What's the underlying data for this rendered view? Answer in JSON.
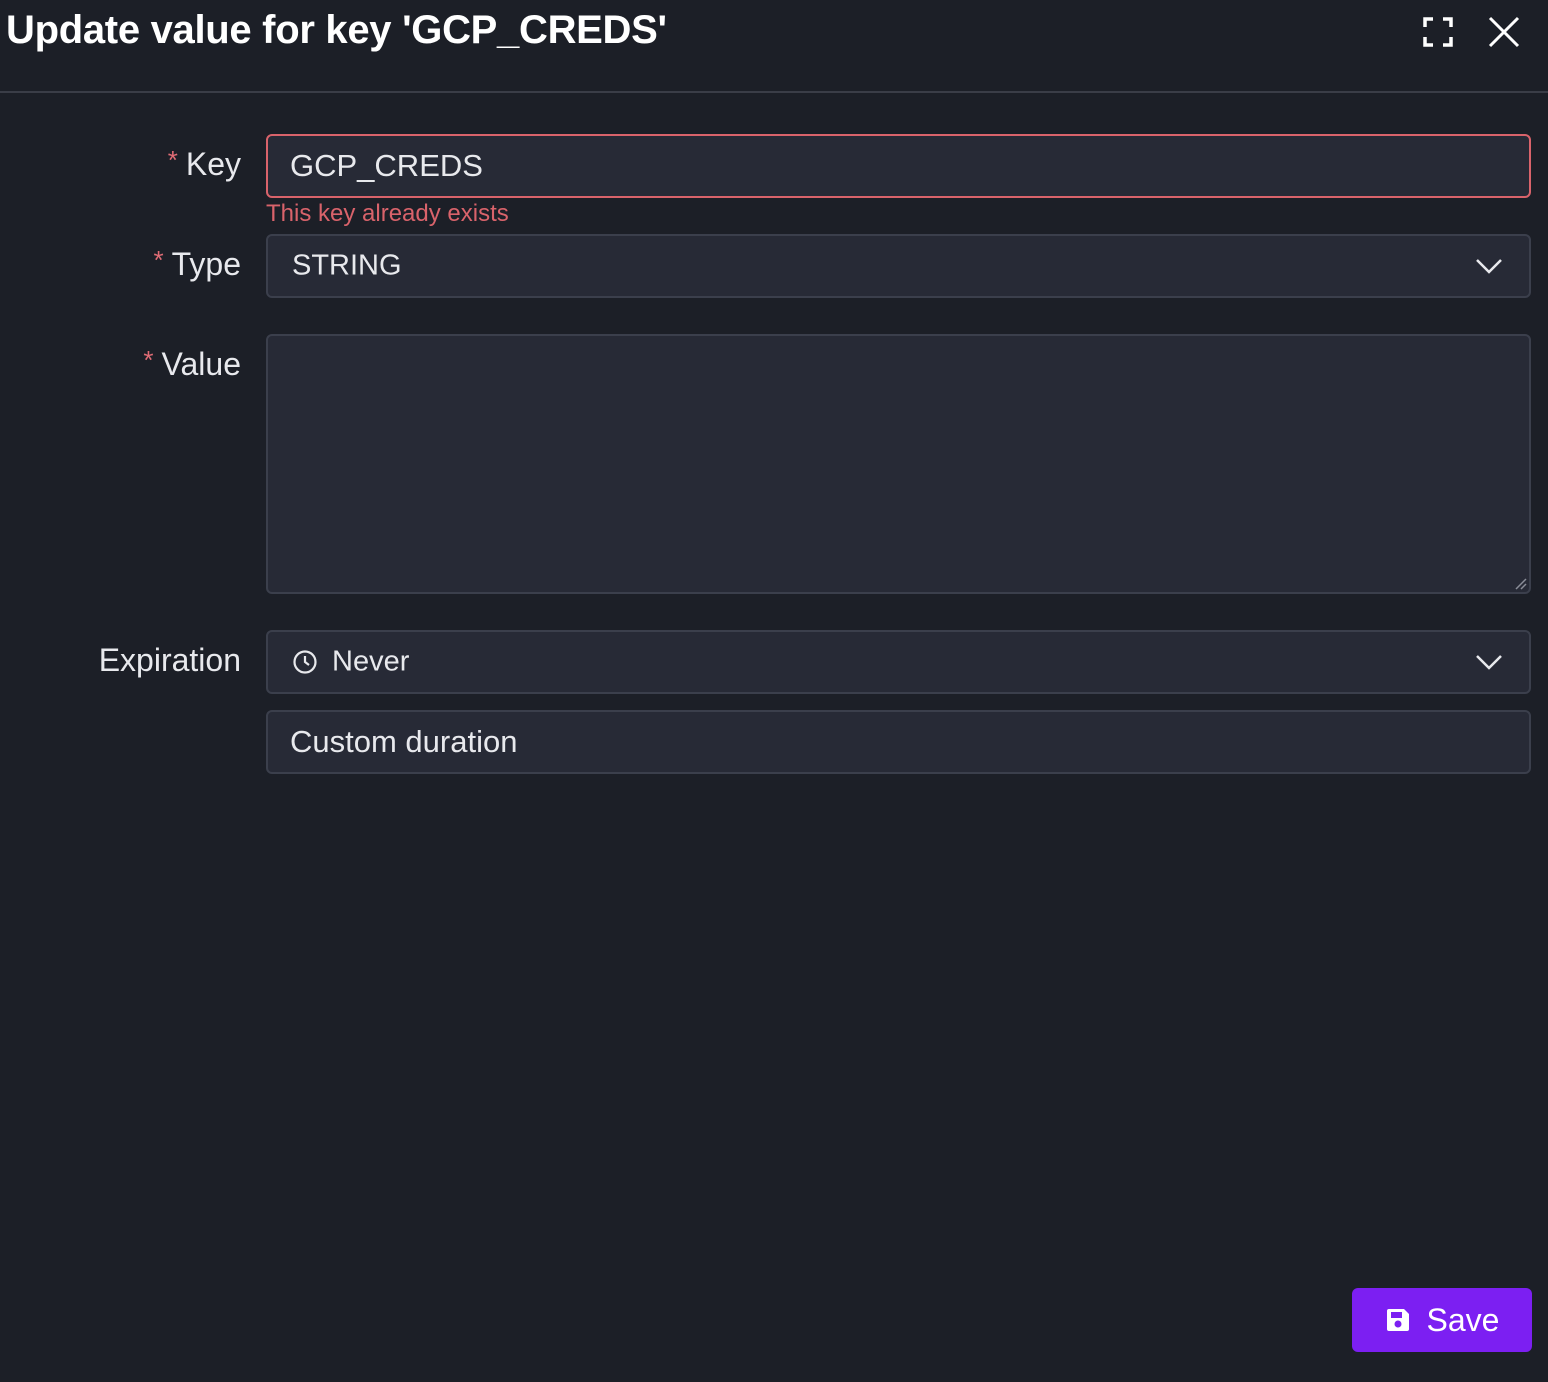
{
  "dialog": {
    "title": "Update value for key 'GCP_CREDS'",
    "expand_icon": "expand-icon",
    "close_icon": "close-icon"
  },
  "form": {
    "key": {
      "required_mark": "*",
      "label": "Key",
      "value": "GCP_CREDS",
      "error": "This key already exists"
    },
    "type": {
      "required_mark": "*",
      "label": "Type",
      "selected": "STRING",
      "icon": "chevron-down-icon"
    },
    "value": {
      "required_mark": "*",
      "label": "Value",
      "content": ""
    },
    "expiration": {
      "label": "Expiration",
      "selected": "Never",
      "icon": "clock-icon",
      "custom_placeholder": "Custom duration"
    }
  },
  "actions": {
    "save_label": "Save",
    "save_icon": "floppy-disk-icon"
  },
  "colors": {
    "background": "#1c1f27",
    "field_background": "#272a36",
    "error": "#d9636b",
    "primary": "#7c1ff2"
  }
}
